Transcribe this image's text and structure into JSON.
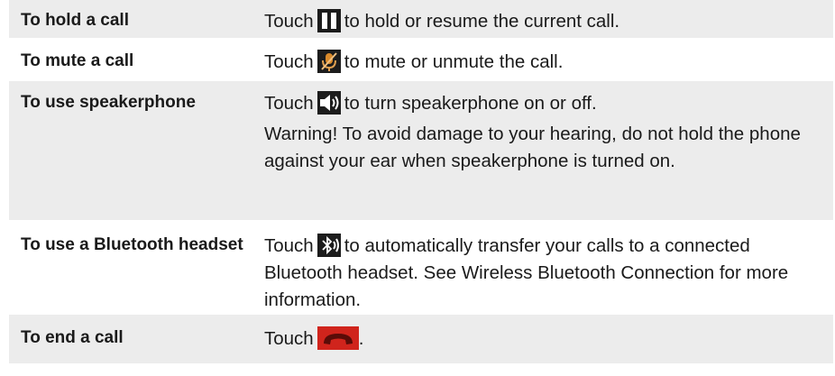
{
  "rows": [
    {
      "label": "To hold a call",
      "pre": "Touch",
      "icon": "pause-icon",
      "post": "to hold or resume the current call."
    },
    {
      "label": "To mute a call",
      "pre": "Touch",
      "icon": "microphone-mute-icon",
      "post": "to mute or unmute the call."
    },
    {
      "label": "To use speakerphone",
      "pre": "Touch",
      "icon": "speaker-icon",
      "post": "to turn speakerphone on or off.",
      "note": "Warning! To avoid damage to your hearing, do not hold the phone against your ear when speakerphone is turned on."
    },
    {
      "label": "To use a Bluetooth headset",
      "pre": "Touch",
      "icon": "bluetooth-icon",
      "post": "to automatically transfer your calls to a connected Bluetooth headset. See Wireless Bluetooth Connection for more information."
    },
    {
      "label": "To end a call",
      "pre": "Touch",
      "icon": "end-call-icon",
      "post": "."
    }
  ],
  "colors": {
    "row_shade": "#ececec",
    "end_call_red": "#d0241c",
    "icon_bg": "#1c1c1c",
    "mic_orange": "#d98a2b"
  }
}
